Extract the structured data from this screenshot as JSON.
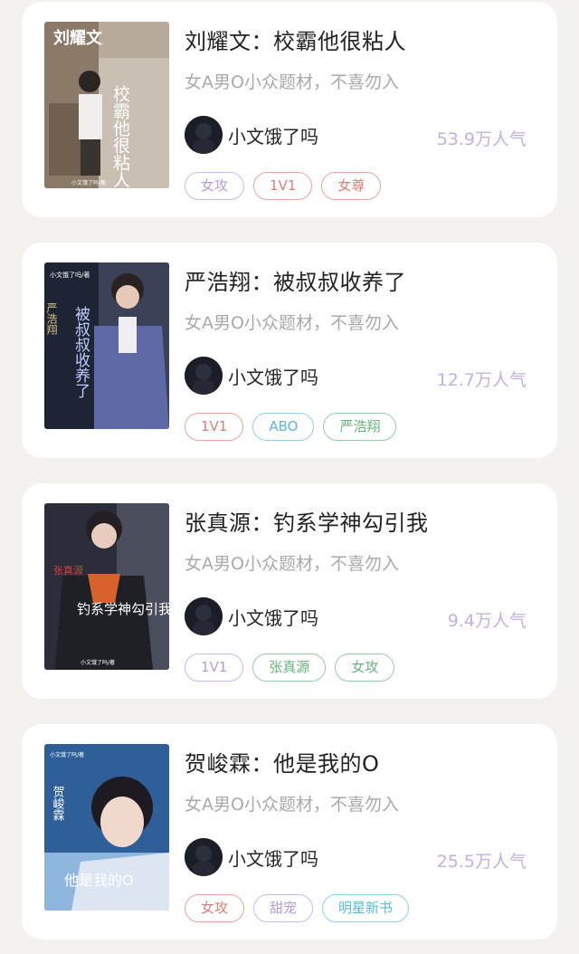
{
  "books": [
    {
      "title": "刘耀文：校霸他很粘人",
      "description": "女A男O小众题材，不喜勿入",
      "author": "小文饿了吗",
      "popularity": "53.9万人气",
      "cover_text": "刘耀文",
      "cover_subtitle": "校霸他很粘人",
      "cover_credit": "小文饿了吗/著",
      "tags": [
        {
          "label": "女攻",
          "color": "purple"
        },
        {
          "label": "1V1",
          "color": "red"
        },
        {
          "label": "女尊",
          "color": "red"
        }
      ]
    },
    {
      "title": "严浩翔：被叔叔收养了",
      "description": "女A男O小众题材，不喜勿入",
      "author": "小文饿了吗",
      "popularity": "12.7万人气",
      "cover_text": "严浩翔",
      "cover_subtitle": "被叔叔收养了",
      "cover_credit": "小文饿了吗/著",
      "tags": [
        {
          "label": "1V1",
          "color": "red"
        },
        {
          "label": "ABO",
          "color": "blue"
        },
        {
          "label": "严浩翔",
          "color": "green"
        }
      ]
    },
    {
      "title": "张真源：钓系学神勾引我",
      "description": "女A男O小众题材，不喜勿入",
      "author": "小文饿了吗",
      "popularity": "9.4万人气",
      "cover_text": "张真源",
      "cover_subtitle": "钓系学神勾引我",
      "cover_credit": "小文饿了吗/著",
      "tags": [
        {
          "label": "1V1",
          "color": "purple"
        },
        {
          "label": "张真源",
          "color": "green"
        },
        {
          "label": "女攻",
          "color": "green"
        }
      ]
    },
    {
      "title": "贺峻霖：他是我的O",
      "description": "女A男O小众题材，不喜勿入",
      "author": "小文饿了吗",
      "popularity": "25.5万人气",
      "cover_text": "贺峻霖",
      "cover_subtitle": "他是我的O",
      "cover_credit": "小文饿了吗/著",
      "tags": [
        {
          "label": "女攻",
          "color": "red"
        },
        {
          "label": "甜宠",
          "color": "purple"
        },
        {
          "label": "明星新书",
          "color": "blue"
        }
      ]
    }
  ]
}
